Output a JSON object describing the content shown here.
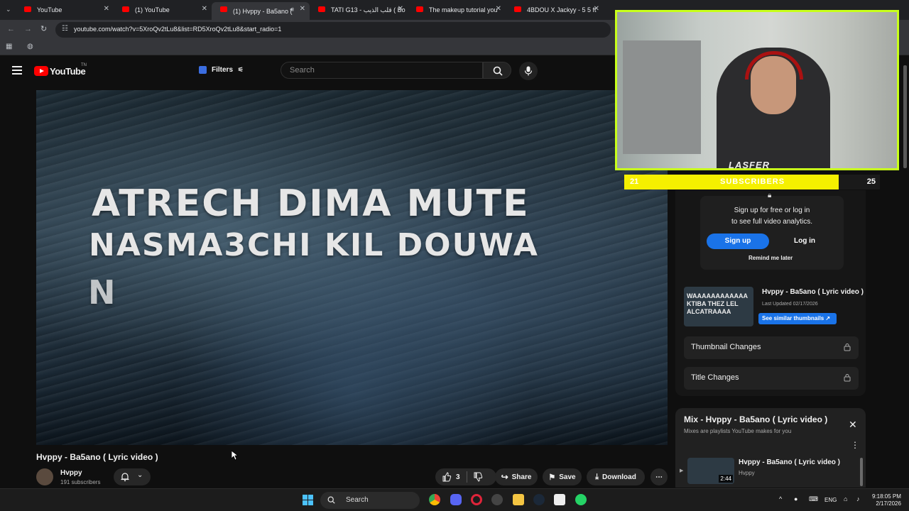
{
  "browser": {
    "tabs": [
      {
        "title": "YouTube",
        "active": false
      },
      {
        "title": "(1) YouTube",
        "active": false
      },
      {
        "title": "(1) Hvppy - Ba5ano (",
        "active": true
      },
      {
        "title": "TATI G13 - قلب الذيب ( Bo",
        "active": false
      },
      {
        "title": "The makeup tutorial you",
        "active": false
      },
      {
        "title": "4BDOU X Jackyy - 5 5 ft",
        "active": false
      }
    ],
    "url": "youtube.com/watch?v=5XroQv2tLu8&list=RD5XroQv2tLu8&start_radio=1"
  },
  "youtube": {
    "logo_text": "YouTube",
    "logo_region": "TN",
    "filters_label": "Filters",
    "search_placeholder": "Search"
  },
  "video": {
    "lyric_line1": "ATRECH DIMA MUTE",
    "lyric_line2": "NASMA3CHI KIL DOUWA",
    "lyric_line3": "N",
    "title": "Hvppy - Ba5ano ( Lyric video )",
    "channel": "Hvppy",
    "subscribers": "191 subscribers",
    "likes": "3",
    "share_label": "Share",
    "save_label": "Save",
    "download_label": "Download"
  },
  "stream_overlay": {
    "brand": "LASFER",
    "current_subs": "21",
    "label": "SUBSCRIBERS",
    "goal": "25",
    "progress": 0.84
  },
  "vidiq": {
    "signup_text_1": "Sign up for free or log in",
    "signup_text_2": "to see full video analytics.",
    "signup_button": "Sign up",
    "login_button": "Log in",
    "remind_later": "Remind me later",
    "thumb_text": "WAAAAAAAAAAAA KTIBA THEZ LEL ALCATRAAAA",
    "video_title": "Hvppy - Ba5ano ( Lyric video )",
    "last_updated": "Last Updated 02/17/2026",
    "similar_button": "See similar thumbnails ↗",
    "thumbnail_changes": "Thumbnail Changes",
    "title_changes": "Title Changes"
  },
  "mix": {
    "title": "Mix - Hvppy - Ba5ano ( Lyric video )",
    "subtitle": "Mixes are playlists YouTube makes for you",
    "item_title": "Hvppy - Ba5ano ( Lyric video )",
    "item_channel": "Hvppy",
    "item_duration": "2:44"
  },
  "taskbar": {
    "search_label": "Search",
    "language": "ENG",
    "time": "9:18:05 PM",
    "date": "2/17/2026"
  },
  "colors": {
    "youtube_red": "#ff0000",
    "cam_border": "#c8ff1a",
    "goal_fill": "#f5f000",
    "vidiq_blue": "#1a73e8"
  }
}
